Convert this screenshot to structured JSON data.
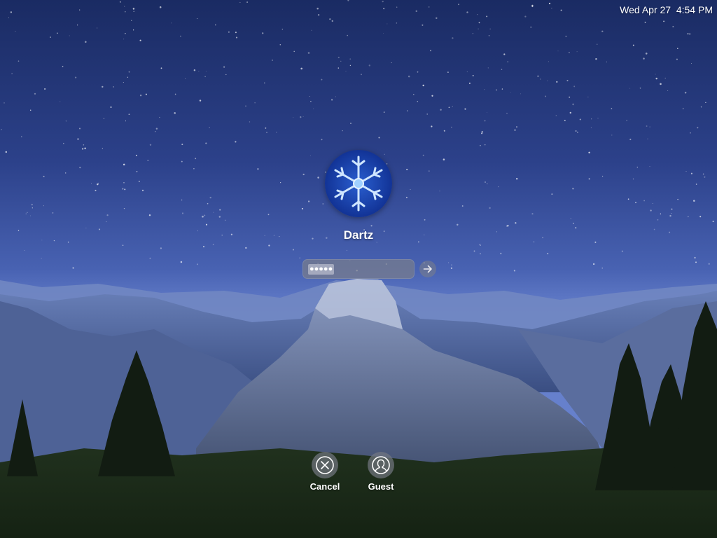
{
  "menubar": {
    "datetime": "Wed Apr 27  4:54 PM"
  },
  "user": {
    "name": "Dartz",
    "avatar_icon": "snowflake-avatar"
  },
  "password": {
    "masked_value": "●●●●●",
    "submit_icon": "arrow-right-icon"
  },
  "actions": {
    "cancel_label": "Cancel",
    "cancel_icon": "x-circle-icon",
    "guest_label": "Guest",
    "guest_icon": "user-silhouette-icon"
  },
  "colors": {
    "sky_top": "#1b2d66",
    "sky_horizon": "#6a84cf",
    "text": "#ffffff"
  }
}
